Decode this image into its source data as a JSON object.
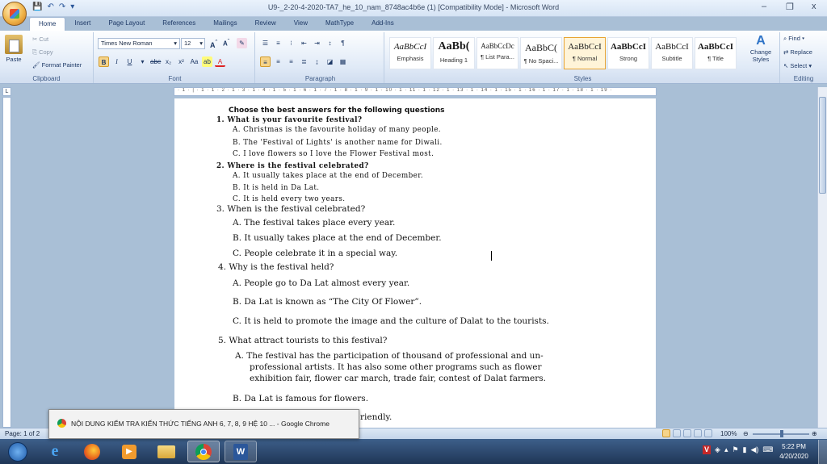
{
  "window": {
    "title": "U9-_2-20-4-2020-TA7_he_10_nam_8748ac4b6e (1) [Compatibility Mode] - Microsoft Word",
    "minimize": "–",
    "restore": "❐",
    "close": "x"
  },
  "tabs": [
    "Home",
    "Insert",
    "Page Layout",
    "References",
    "Mailings",
    "Review",
    "View",
    "MathType",
    "Add-Ins"
  ],
  "ribbon": {
    "clipboard": {
      "label": "Clipboard",
      "paste": "Paste",
      "cut": "Cut",
      "copy": "Copy",
      "format_painter": "Format Painter"
    },
    "font": {
      "label": "Font",
      "family": "Times New Roman",
      "size": "12"
    },
    "paragraph": {
      "label": "Paragraph"
    },
    "styles": {
      "label": "Styles",
      "items": [
        {
          "preview": "AaBbCcI",
          "name": "Emphasis"
        },
        {
          "preview": "AaBb(",
          "name": "Heading 1"
        },
        {
          "preview": "AaBbCcDc",
          "name": "¶ List Para..."
        },
        {
          "preview": "AaBbC(",
          "name": "¶ No Spaci..."
        },
        {
          "preview": "AaBbCcI",
          "name": "¶ Normal"
        },
        {
          "preview": "AaBbCcI",
          "name": "Strong"
        },
        {
          "preview": "AaBbCcI",
          "name": "Subtitle"
        },
        {
          "preview": "AaBbCcI",
          "name": "¶ Title"
        }
      ],
      "change_styles": "Change Styles"
    },
    "editing": {
      "label": "Editing",
      "find": "Find",
      "replace": "Replace",
      "select": "Select"
    }
  },
  "ruler": "· 1 · | · 1 · 1 · 2 · 1 · 3 · 1 · 4 · 1 · 5 · 1 · 6 · 1 · 7 · 1 · 8 · 1 · 9 · 1 · 10 · 1 · 11 · 1 · 12 · 1 · 13 · 1 · 14 · 1 · 15 · 1 · 16 · 1 · 17 · 1 · 18 · 1 · 19 ·",
  "document": {
    "heading": "Choose the best answers for the following questions",
    "lines": [
      "1.   What is your favourite festival?",
      "A. Christmas is the favourite holiday of many people.",
      "B. The 'Festival of Lights' is another name for Diwali.",
      "C. I love flowers so I love the Flower Festival most.",
      "2.   Where is the festival celebrated?",
      "A. It usually takes place at the end of December.",
      "B. It is held in Da Lat.",
      "C. It is held every two years.",
      "3.   When is the festival celebrated?",
      "A. The festival takes place every year.",
      "B. It usually takes place at the end of December.",
      "C. People celebrate it in a special way.",
      "4. Why is the festival held?",
      "A. People go to Da Lat almost every year.",
      "B. Da Lat is known as “The City Of Flower”.",
      "C. It is held to promote the image and the culture of Dalat to the tourists.",
      "5.  What attract tourists to this festival?",
      "A. The festival has the participation of thousand of professional and un-",
      "professional artists. It has also some other programs such as flower",
      "exhibition fair, flower car march, trade fair, contest of Dalat farmers.",
      "B. Da Lat is famous for flowers.",
      "riendly."
    ]
  },
  "status": {
    "page": "Page: 1 of 2",
    "zoom": "100%"
  },
  "popup": {
    "text": "NỘI DUNG KIỂM TRA KIẾN THỨC TIẾNG ANH 6, 7, 8, 9 HỆ 10 ... - Google Chrome"
  },
  "clock": {
    "time": "5:22 PM",
    "date": "4/20/2020"
  }
}
